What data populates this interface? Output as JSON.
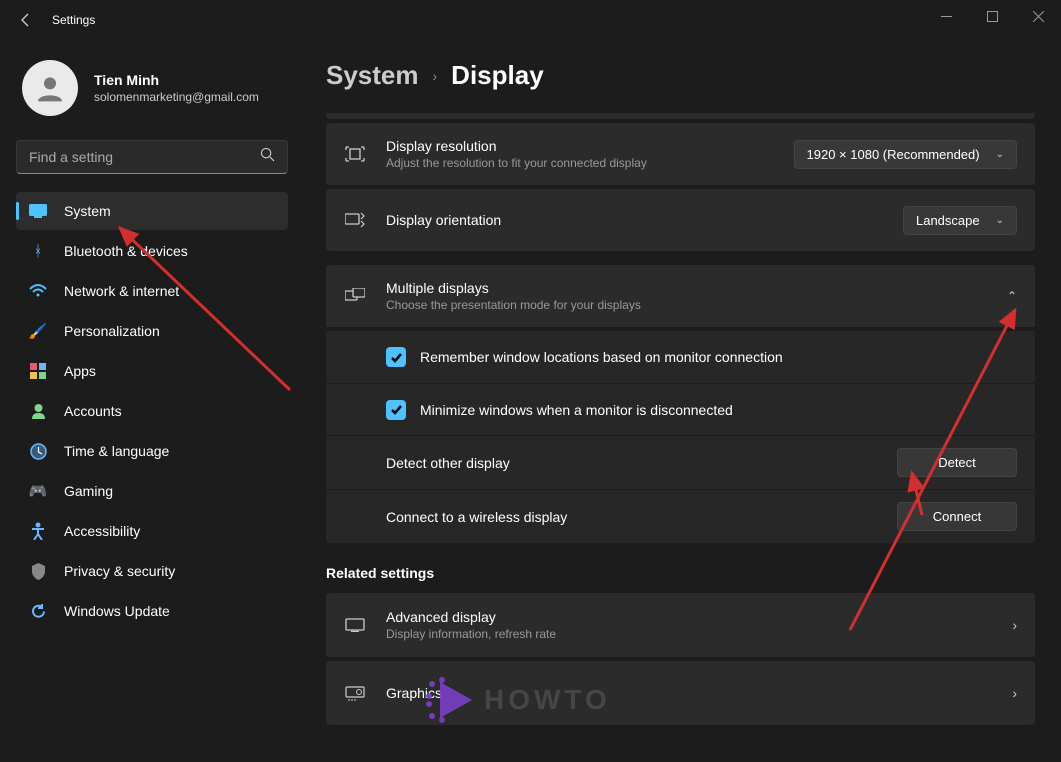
{
  "app": {
    "title": "Settings"
  },
  "profile": {
    "name": "Tien Minh",
    "email": "solomenmarketing@gmail.com"
  },
  "search": {
    "placeholder": "Find a setting"
  },
  "nav": {
    "items": [
      {
        "label": "System",
        "icon": "🖥️",
        "active": true
      },
      {
        "label": "Bluetooth & devices",
        "icon": "bluetooth"
      },
      {
        "label": "Network & internet",
        "icon": "wifi"
      },
      {
        "label": "Personalization",
        "icon": "brush"
      },
      {
        "label": "Apps",
        "icon": "apps"
      },
      {
        "label": "Accounts",
        "icon": "person"
      },
      {
        "label": "Time & language",
        "icon": "clock"
      },
      {
        "label": "Gaming",
        "icon": "gamepad"
      },
      {
        "label": "Accessibility",
        "icon": "accessibility"
      },
      {
        "label": "Privacy & security",
        "icon": "shield"
      },
      {
        "label": "Windows Update",
        "icon": "update"
      }
    ]
  },
  "breadcrumb": {
    "parent": "System",
    "current": "Display"
  },
  "resolution": {
    "title": "Display resolution",
    "sub": "Adjust the resolution to fit your connected display",
    "value": "1920 × 1080 (Recommended)"
  },
  "orientation": {
    "title": "Display orientation",
    "value": "Landscape"
  },
  "multiple": {
    "title": "Multiple displays",
    "sub": "Choose the presentation mode for your displays",
    "checkbox1": "Remember window locations based on monitor connection",
    "checkbox2": "Minimize windows when a monitor is disconnected",
    "detect_label": "Detect other display",
    "detect_btn": "Detect",
    "connect_label": "Connect to a wireless display",
    "connect_btn": "Connect"
  },
  "related": {
    "heading": "Related settings",
    "advanced_title": "Advanced display",
    "advanced_sub": "Display information, refresh rate",
    "graphics_title": "Graphics"
  },
  "watermark": {
    "text": "HOWTO"
  },
  "colors": {
    "accent": "#4cc2ff",
    "annotation": "#d32f2f"
  }
}
